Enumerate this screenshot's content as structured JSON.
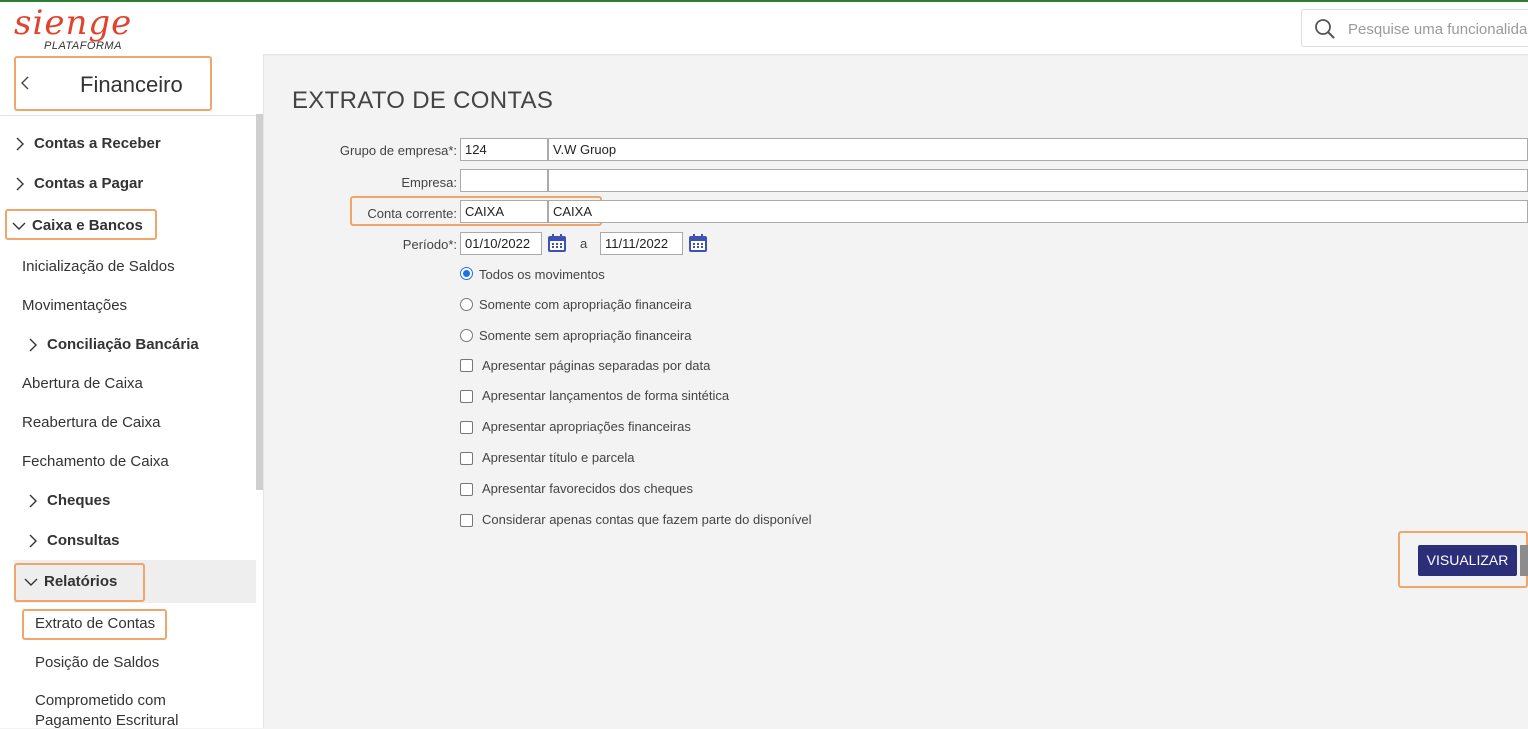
{
  "brand": {
    "logo_main": "sienge",
    "logo_sub": "PLATAFORMA",
    "accent": "#e0442f"
  },
  "search": {
    "placeholder": "Pesquise uma funcionalidade"
  },
  "sidebar": {
    "title": "Financeiro",
    "items": [
      {
        "label": "Contas a Receber"
      },
      {
        "label": "Contas a Pagar"
      },
      {
        "label": "Caixa e Bancos"
      },
      {
        "label": "Inicialização de Saldos"
      },
      {
        "label": "Movimentações"
      },
      {
        "label": "Conciliação Bancária"
      },
      {
        "label": "Abertura de Caixa"
      },
      {
        "label": "Reabertura de Caixa"
      },
      {
        "label": "Fechamento de Caixa"
      },
      {
        "label": "Cheques"
      },
      {
        "label": "Consultas"
      },
      {
        "label": "Relatórios"
      },
      {
        "label": "Extrato de Contas"
      },
      {
        "label": "Posição de Saldos"
      },
      {
        "label": "Comprometido com"
      },
      {
        "label": "Pagamento Escritural"
      }
    ]
  },
  "main": {
    "title": "EXTRATO DE CONTAS",
    "fields": {
      "grupo_label": "Grupo de empresa*:",
      "grupo_code": "124",
      "grupo_name": "V.W Gruop",
      "empresa_label": "Empresa:",
      "empresa_code": "",
      "empresa_name": "",
      "conta_label": "Conta corrente:",
      "conta_code": "CAIXA",
      "conta_name": "CAIXA",
      "periodo_label": "Período*:",
      "periodo_from": "01/10/2022",
      "periodo_sep": "a",
      "periodo_to": "11/11/2022"
    },
    "radios": [
      {
        "label": "Todos os movimentos",
        "checked": true
      },
      {
        "label": "Somente com apropriação financeira",
        "checked": false
      },
      {
        "label": "Somente sem apropriação financeira",
        "checked": false
      }
    ],
    "checks": [
      {
        "label": "Apresentar páginas separadas por data",
        "checked": false
      },
      {
        "label": "Apresentar lançamentos de forma sintética",
        "checked": false
      },
      {
        "label": "Apresentar apropriações financeiras",
        "checked": false
      },
      {
        "label": "Apresentar título e parcela",
        "checked": false
      },
      {
        "label": "Apresentar favorecidos dos cheques",
        "checked": false
      },
      {
        "label": "Considerar apenas contas que fazem parte do disponível",
        "checked": false
      }
    ],
    "button_label": "VISUALIZAR"
  },
  "colors": {
    "highlight": "#f0a66a",
    "button": "#2b2f7a",
    "radio": "#1a73e8"
  }
}
